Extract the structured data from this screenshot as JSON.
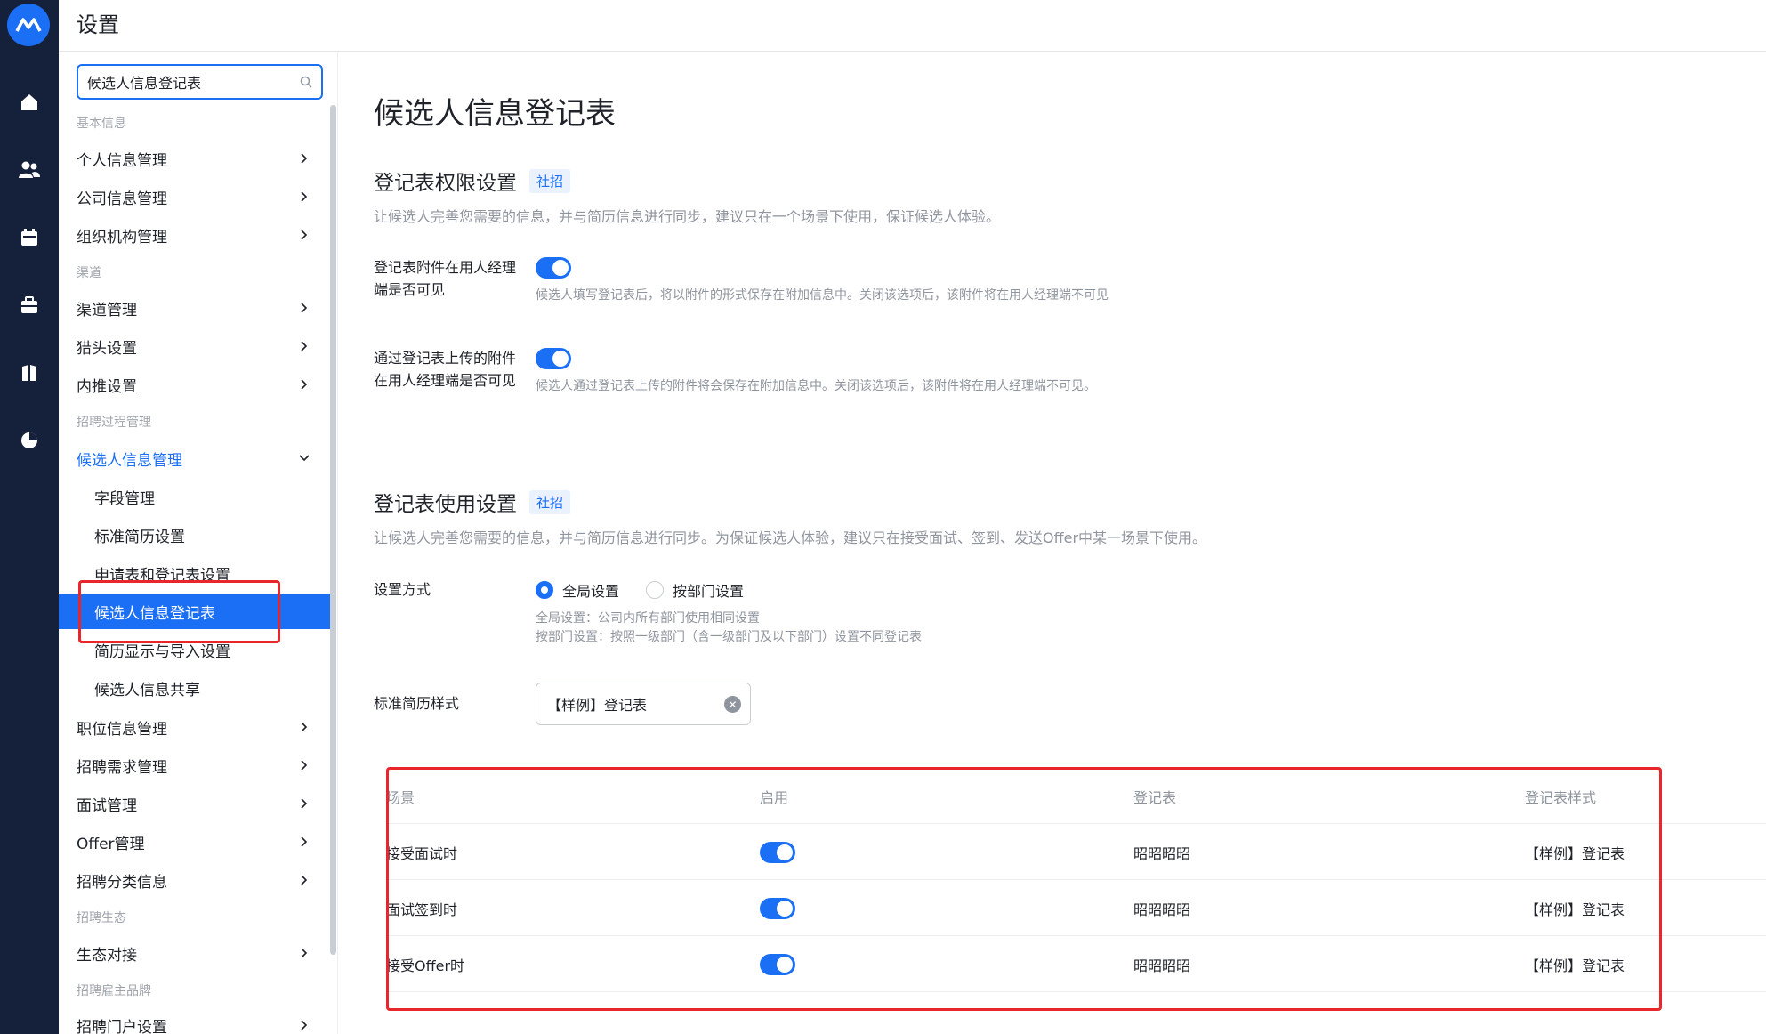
{
  "header": {
    "title": "设置"
  },
  "rail": {
    "icons": [
      "logo-icon",
      "home-icon",
      "people-icon",
      "calendar-icon",
      "briefcase-icon",
      "book-icon",
      "pie-chart-icon"
    ]
  },
  "sidebar": {
    "search_value": "候选人信息登记表",
    "groups": {
      "basic": "基本信息",
      "channel": "渠道",
      "process": "招聘过程管理",
      "ecosystem": "招聘生态",
      "brand": "招聘雇主品牌"
    },
    "items": {
      "personal": "个人信息管理",
      "company": "公司信息管理",
      "org": "组织机构管理",
      "channel_mgmt": "渠道管理",
      "headhunter": "猎头设置",
      "referral": "内推设置",
      "candidate_mgmt": "候选人信息管理",
      "position": "职位信息管理",
      "demand": "招聘需求管理",
      "interview": "面试管理",
      "offer": "Offer管理",
      "category": "招聘分类信息",
      "eco_connect": "生态对接",
      "portal": "招聘门户设置"
    },
    "subitems": {
      "fields": "字段管理",
      "std_resume": "标准简历设置",
      "forms": "申请表和登记表设置",
      "register": "候选人信息登记表",
      "display": "简历显示与导入设置",
      "share": "候选人信息共享"
    }
  },
  "main": {
    "title": "候选人信息登记表",
    "perm": {
      "title": "登记表权限设置",
      "tag": "社招",
      "desc": "让候选人完善您需要的信息，并与简历信息进行同步，建议只在一个场景下使用，保证候选人体验。",
      "opt1_label": "登记表附件在用人经理端是否可见",
      "opt1_note": "候选人填写登记表后，将以附件的形式保存在附加信息中。关闭该选项后，该附件将在用人经理端不可见",
      "opt1_on": true,
      "opt2_label": "通过登记表上传的附件在用人经理端是否可见",
      "opt2_note": "候选人通过登记表上传的附件将会保存在附加信息中。关闭该选项后，该附件将在用人经理端不可见。",
      "opt2_on": true
    },
    "usage": {
      "title": "登记表使用设置",
      "tag": "社招",
      "desc": "让候选人完善您需要的信息，并与简历信息进行同步。为保证候选人体验，建议只在接受面试、签到、发送Offer中某一场景下使用。",
      "mode_label": "设置方式",
      "mode_options": [
        "全局设置",
        "按部门设置"
      ],
      "mode_selected": "全局设置",
      "mode_note1": "全局设置：公司内所有部门使用相同设置",
      "mode_note2": "按部门设置：按照一级部门（含一级部门及以下部门）设置不同登记表",
      "style_label": "标准简历样式",
      "style_value": "【样例】登记表"
    },
    "table": {
      "headers": [
        "场景",
        "启用",
        "登记表",
        "登记表样式"
      ],
      "rows": [
        {
          "scene": "接受面试时",
          "enabled": true,
          "form": "昭昭昭昭",
          "style": "【样例】登记表"
        },
        {
          "scene": "面试签到时",
          "enabled": true,
          "form": "昭昭昭昭",
          "style": "【样例】登记表"
        },
        {
          "scene": "接受Offer时",
          "enabled": true,
          "form": "昭昭昭昭",
          "style": "【样例】登记表"
        }
      ]
    }
  },
  "colors": {
    "accent": "#1b6ff5",
    "rail": "#15213b",
    "highlight_box": "#e8262b"
  }
}
